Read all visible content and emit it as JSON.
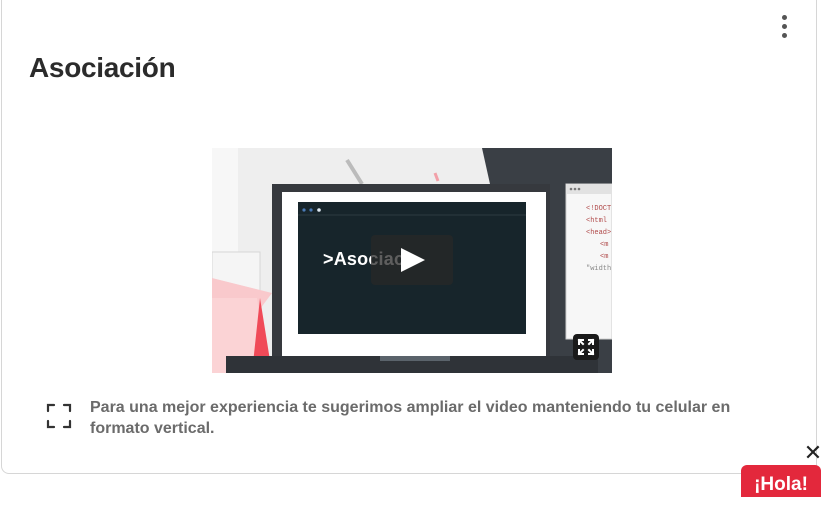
{
  "card": {
    "title": "Asociación",
    "menu_icon": "more-vertical-icon"
  },
  "video": {
    "overlay_text": ">Asociaci",
    "play_icon": "play-icon",
    "fullscreen_icon": "fullscreen-icon",
    "code_lines": [
      "<!DOCT",
      "<html",
      "<head>",
      "<m",
      "<m",
      "\"width"
    ]
  },
  "hint": {
    "icon": "expand-frame-icon",
    "text": "Para una mejor experiencia te sugerimos ampliar el video manteniendo tu celular en formato vertical."
  },
  "chat": {
    "close_icon": "close-icon",
    "close_glyph": "✕",
    "label": "¡Hola!"
  },
  "colors": {
    "accent_red": "#e3283c",
    "title": "#2b2b2b",
    "hint_text": "#6b6b6b"
  }
}
